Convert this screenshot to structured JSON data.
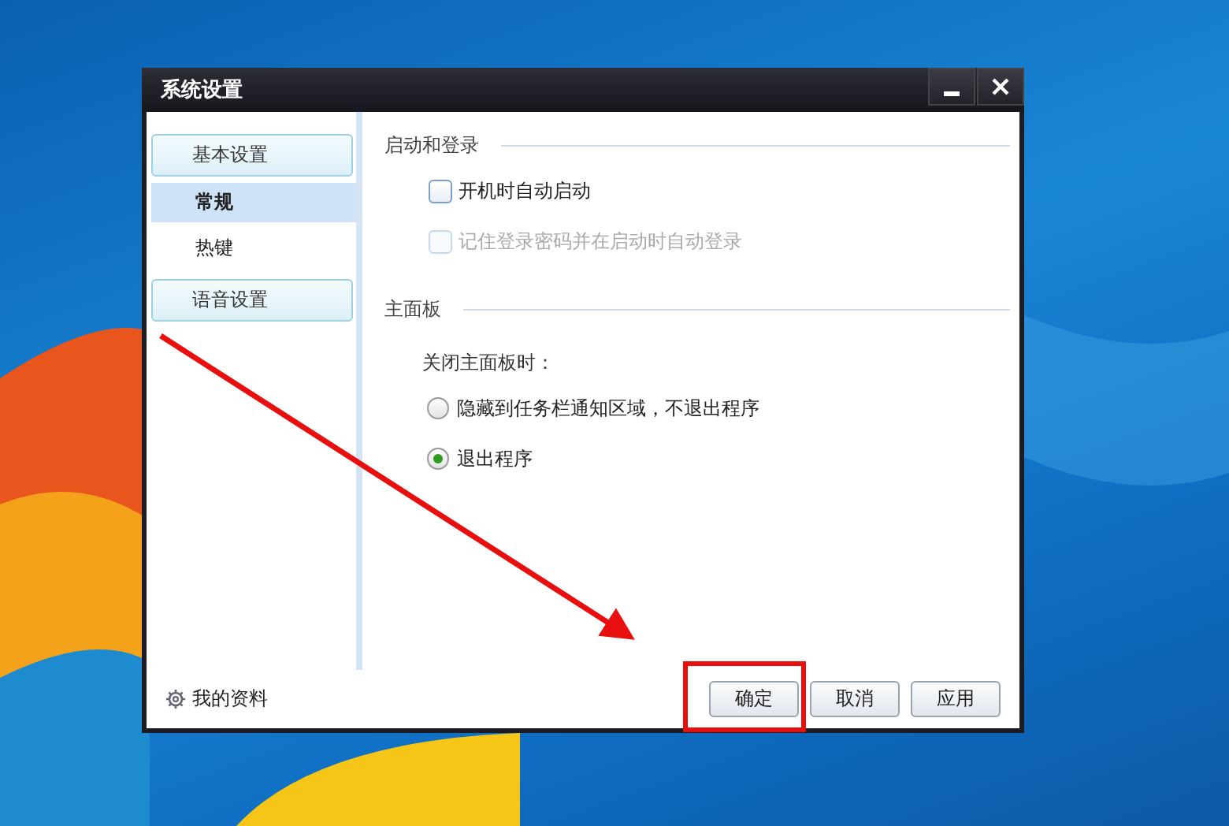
{
  "window": {
    "title": "系统设置"
  },
  "sidebar": {
    "items": [
      {
        "kind": "header",
        "label": "基本设置",
        "selected": false
      },
      {
        "kind": "item",
        "label": "常规",
        "selected": true
      },
      {
        "kind": "item",
        "label": "热键",
        "selected": false
      },
      {
        "kind": "header",
        "label": "语音设置",
        "selected": false
      }
    ]
  },
  "sections": [
    {
      "title": "启动和登录",
      "options": [
        {
          "kind": "checkbox",
          "label": "开机时自动启动",
          "checked": false,
          "disabled": false
        },
        {
          "kind": "checkbox",
          "label": "记住登录密码并在启动时自动登录",
          "checked": false,
          "disabled": true
        }
      ]
    },
    {
      "title": "主面板",
      "options": [
        {
          "kind": "prompt",
          "label": "关闭主面板时："
        },
        {
          "kind": "radio",
          "label": "隐藏到任务栏通知区域，不退出程序",
          "selected": false
        },
        {
          "kind": "radio",
          "label": "退出程序",
          "selected": true
        }
      ]
    }
  ],
  "footer": {
    "profile_link": "我的资料",
    "buttons": [
      "确定",
      "取消",
      "应用"
    ]
  }
}
